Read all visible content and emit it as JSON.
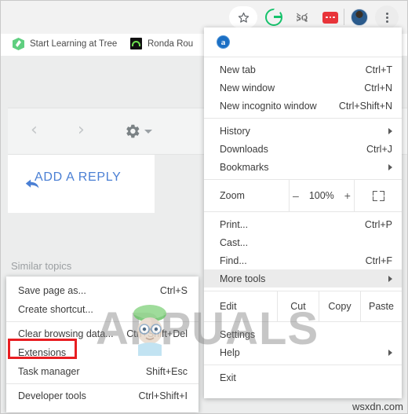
{
  "toolbar": {
    "icons": [
      {
        "name": "bookmark-star-icon",
        "label": "Bookmark this page"
      },
      {
        "name": "grammarly-extension-icon",
        "label": "Grammarly"
      },
      {
        "name": "sq-extension-icon",
        "label": "SQ"
      },
      {
        "name": "red-extension-icon",
        "label": "Extension"
      },
      {
        "name": "profile-avatar",
        "label": "Profile"
      },
      {
        "name": "chrome-menu-icon",
        "label": "Customize and control Google Chrome"
      }
    ]
  },
  "bookmarks_bar": {
    "items": [
      {
        "label": "Start Learning at Tree",
        "icon": "treehouse-favicon"
      },
      {
        "label": "Ronda Rou",
        "icon": "black-favicon"
      }
    ]
  },
  "page": {
    "nav_prev": "‹",
    "nav_next": "›",
    "gear_icon": "gear-icon",
    "add_reply_label": "ADD A REPLY",
    "similar_topics_label": "Similar topics"
  },
  "chrome_menu": {
    "extension_icon_letter": "a",
    "groups": [
      {
        "items": [
          {
            "label": "New tab",
            "accel": "Ctrl+T",
            "submenu": false
          },
          {
            "label": "New window",
            "accel": "Ctrl+N",
            "submenu": false
          },
          {
            "label": "New incognito window",
            "accel": "Ctrl+Shift+N",
            "submenu": false
          }
        ]
      },
      {
        "items": [
          {
            "label": "History",
            "accel": "",
            "submenu": true
          },
          {
            "label": "Downloads",
            "accel": "Ctrl+J",
            "submenu": false
          },
          {
            "label": "Bookmarks",
            "accel": "",
            "submenu": true
          }
        ]
      },
      {
        "items": [
          {
            "label": "Print...",
            "accel": "Ctrl+P",
            "submenu": false
          },
          {
            "label": "Cast...",
            "accel": "",
            "submenu": false
          },
          {
            "label": "Find...",
            "accel": "Ctrl+F",
            "submenu": false
          },
          {
            "label": "More tools",
            "accel": "",
            "submenu": true,
            "highlighted": true
          }
        ]
      },
      {
        "items": [
          {
            "label": "Settings",
            "accel": "",
            "submenu": false
          },
          {
            "label": "Help",
            "accel": "",
            "submenu": true
          }
        ]
      },
      {
        "items": [
          {
            "label": "Exit",
            "accel": "",
            "submenu": false
          }
        ]
      }
    ],
    "zoom_row": {
      "label": "Zoom",
      "minus": "–",
      "value": "100%",
      "plus": "+",
      "fullscreen_icon": "fullscreen-icon"
    },
    "edit_row": {
      "label": "Edit",
      "cut": "Cut",
      "copy": "Copy",
      "paste": "Paste"
    }
  },
  "more_tools_submenu": {
    "groups": [
      {
        "items": [
          {
            "label": "Save page as...",
            "accel": "Ctrl+S"
          },
          {
            "label": "Create shortcut...",
            "accel": ""
          }
        ]
      },
      {
        "items": [
          {
            "label": "Clear browsing data...",
            "accel": "Ctrl+Shift+Del"
          },
          {
            "label": "Extensions",
            "accel": "",
            "highlighted_box": true
          },
          {
            "label": "Task manager",
            "accel": "Shift+Esc"
          }
        ]
      },
      {
        "items": [
          {
            "label": "Developer tools",
            "accel": "Ctrl+Shift+I"
          }
        ]
      }
    ]
  },
  "watermarks": {
    "appuals": "APPUALS",
    "wsxdn": "wsxdn.com"
  },
  "colors": {
    "highlight_box": "#e81e22",
    "link_blue": "#4a7fd4",
    "menu_bg": "#ffffff",
    "page_bg": "#eceded",
    "grammarly_green": "#15c26b",
    "red_extension": "#e8343a"
  }
}
